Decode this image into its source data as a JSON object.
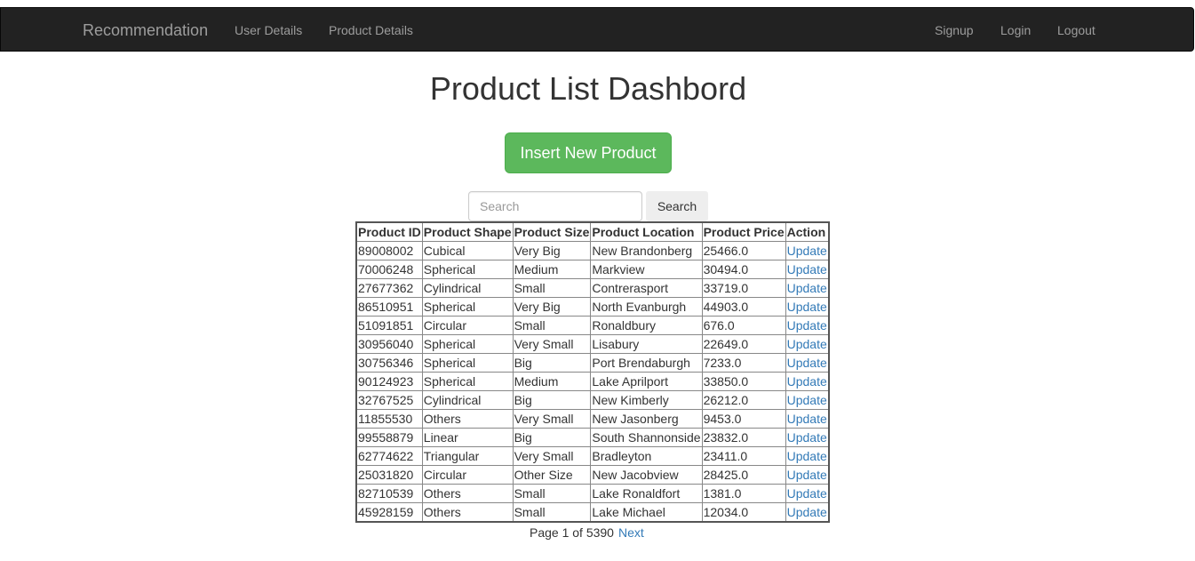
{
  "navbar": {
    "brand": "Recommendation",
    "links": [
      "User Details",
      "Product Details"
    ],
    "right_links": [
      "Signup",
      "Login",
      "Logout"
    ]
  },
  "page": {
    "title": "Product List Dashbord",
    "insert_button": "Insert New Product"
  },
  "search": {
    "placeholder": "Search",
    "button": "Search"
  },
  "table": {
    "headers": [
      "Product ID",
      "Product Shape",
      "Product Size",
      "Product Location",
      "Product Price",
      "Action"
    ],
    "rows": [
      [
        "89008002",
        "Cubical",
        "Very Big",
        "New Brandonberg",
        "25466.0",
        "Update"
      ],
      [
        "70006248",
        "Spherical",
        "Medium",
        "Markview",
        "30494.0",
        "Update"
      ],
      [
        "27677362",
        "Cylindrical",
        "Small",
        "Contrerasport",
        "33719.0",
        "Update"
      ],
      [
        "86510951",
        "Spherical",
        "Very Big",
        "North Evanburgh",
        "44903.0",
        "Update"
      ],
      [
        "51091851",
        "Circular",
        "Small",
        "Ronaldbury",
        "676.0",
        "Update"
      ],
      [
        "30956040",
        "Spherical",
        "Very Small",
        "Lisabury",
        "22649.0",
        "Update"
      ],
      [
        "30756346",
        "Spherical",
        "Big",
        "Port Brendaburgh",
        "7233.0",
        "Update"
      ],
      [
        "90124923",
        "Spherical",
        "Medium",
        "Lake Aprilport",
        "33850.0",
        "Update"
      ],
      [
        "32767525",
        "Cylindrical",
        "Big",
        "New Kimberly",
        "26212.0",
        "Update"
      ],
      [
        "11855530",
        "Others",
        "Very Small",
        "New Jasonberg",
        "9453.0",
        "Update"
      ],
      [
        "99558879",
        "Linear",
        "Big",
        "South Shannonside",
        "23832.0",
        "Update"
      ],
      [
        "62774622",
        "Triangular",
        "Very Small",
        "Bradleyton",
        "23411.0",
        "Update"
      ],
      [
        "25031820",
        "Circular",
        "Other Size",
        "New Jacobview",
        "28425.0",
        "Update"
      ],
      [
        "82710539",
        "Others",
        "Small",
        "Lake Ronaldfort",
        "1381.0",
        "Update"
      ],
      [
        "45928159",
        "Others",
        "Small",
        "Lake Michael",
        "12034.0",
        "Update"
      ]
    ]
  },
  "pagination": {
    "text": "Page 1 of 5390",
    "next": "Next"
  }
}
